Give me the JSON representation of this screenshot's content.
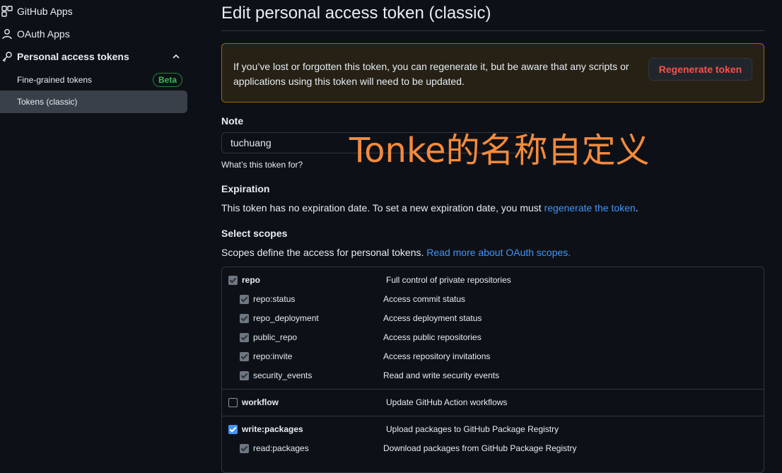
{
  "sidebar": {
    "github_apps": "GitHub Apps",
    "oauth_apps": "OAuth Apps",
    "personal_tokens": "Personal access tokens",
    "fine_grained": "Fine-grained tokens",
    "beta_badge": "Beta",
    "tokens_classic": "Tokens (classic)"
  },
  "page": {
    "title": "Edit personal access token (classic)"
  },
  "flash": {
    "message": "If you’ve lost or forgotten this token, you can regenerate it, but be aware that any scripts or applications using this token will need to be updated.",
    "button": "Regenerate token"
  },
  "note": {
    "label": "Note",
    "value": "tuchuang",
    "hint": "What’s this token for?"
  },
  "annotation": "Tonke的名称自定义",
  "expiration": {
    "label": "Expiration",
    "text": "This token has no expiration date. To set a new expiration date, you must ",
    "link": "regenerate the token",
    "suffix": "."
  },
  "scopes": {
    "label": "Select scopes",
    "text": "Scopes define the access for personal tokens. ",
    "link": "Read more about OAuth scopes.",
    "items": [
      {
        "name": "repo",
        "desc": "Full control of private repositories"
      },
      {
        "name": "repo:status",
        "desc": "Access commit status"
      },
      {
        "name": "repo_deployment",
        "desc": "Access deployment status"
      },
      {
        "name": "public_repo",
        "desc": "Access public repositories"
      },
      {
        "name": "repo:invite",
        "desc": "Access repository invitations"
      },
      {
        "name": "security_events",
        "desc": "Read and write security events"
      },
      {
        "name": "workflow",
        "desc": "Update GitHub Action workflows"
      },
      {
        "name": "write:packages",
        "desc": "Upload packages to GitHub Package Registry"
      },
      {
        "name": "read:packages",
        "desc": "Download packages from GitHub Package Registry"
      }
    ]
  },
  "colors": {
    "background": "#0d1117",
    "link": "#4493f8",
    "danger": "#f85149",
    "warning_border": "#9e6a03",
    "annotation": "#f58a3c",
    "beta": "#3fb950"
  }
}
